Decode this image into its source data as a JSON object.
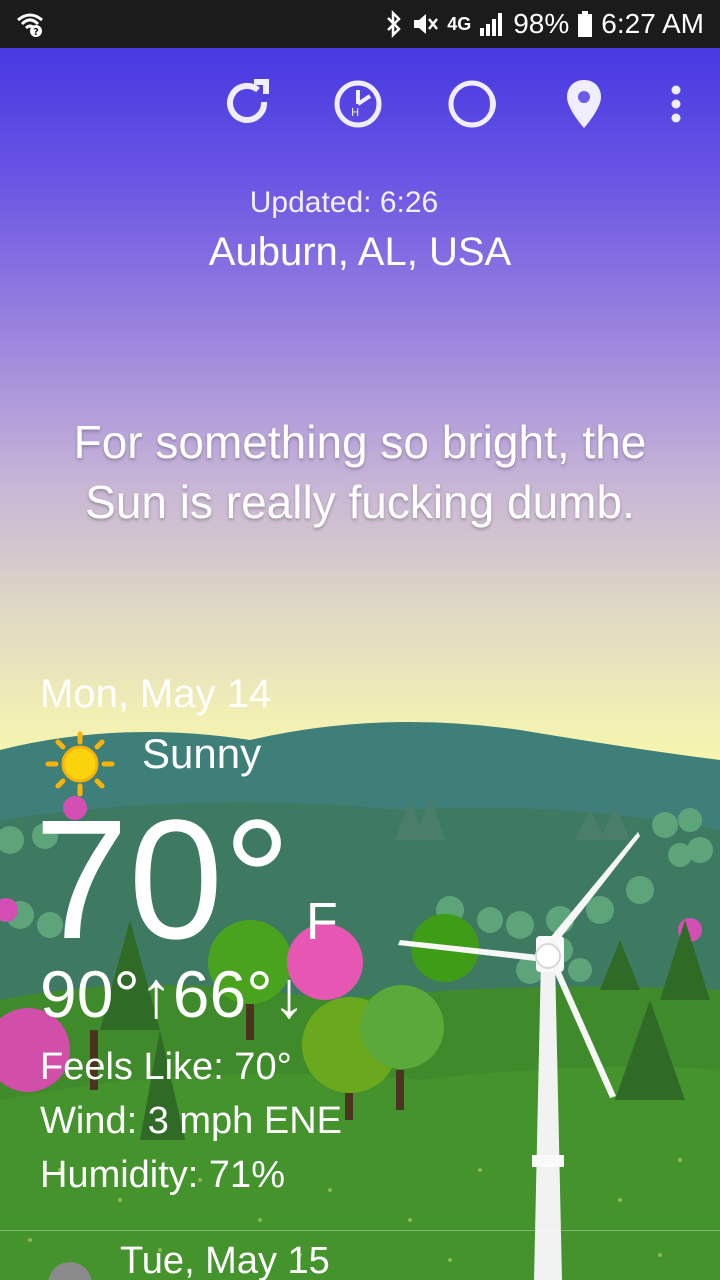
{
  "status_bar": {
    "battery": "98%",
    "time": "6:27 AM",
    "network": "4G",
    "icons": [
      "wifi-question-icon",
      "bluetooth-icon",
      "mute-icon",
      "4g-icon",
      "signal-icon",
      "battery-icon"
    ]
  },
  "toolbar": {
    "buttons": [
      "refresh-icon",
      "hourly-clock-icon",
      "moon-phase-icon",
      "location-pin-icon",
      "more-vert-icon"
    ]
  },
  "header": {
    "updated": "Updated: 6:26",
    "location": "Auburn, AL, USA"
  },
  "quote": "For something so bright, the Sun is really fucking dumb.",
  "today": {
    "date": "Mon, May 14",
    "condition": "Sunny",
    "condition_icon": "sun-icon",
    "temp": "70°",
    "unit": "F",
    "hilo": "90°↑66°↓",
    "feels_like": "Feels Like: 70°",
    "wind": "Wind: 3 mph ENE",
    "humidity": "Humidity: 71%"
  },
  "next_day": {
    "date": "Tue, May 15"
  },
  "colors": {
    "sky_top": "#3a2ee0",
    "sky_horizon": "#f7f6ae",
    "grass": "#3f8a2a",
    "status_bar": "#1b1b1b"
  }
}
